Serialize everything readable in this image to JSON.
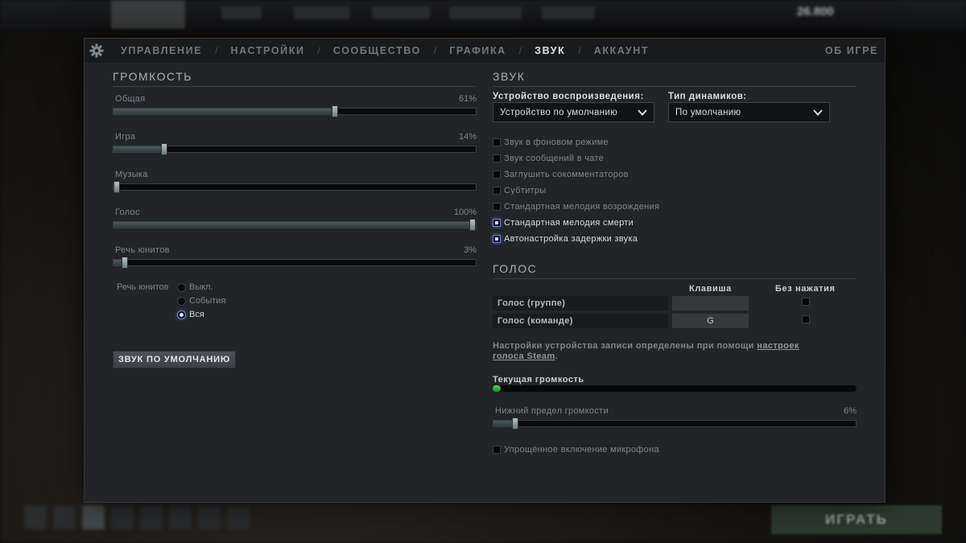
{
  "background": {
    "coins": "26.800",
    "play_label": "ИГРАТЬ"
  },
  "tabs": [
    {
      "label": "УПРАВЛЕНИЕ",
      "active": false
    },
    {
      "label": "НАСТРОЙКИ",
      "active": false
    },
    {
      "label": "СООБЩЕСТВО",
      "active": false
    },
    {
      "label": "ГРАФИКА",
      "active": false
    },
    {
      "label": "ЗВУК",
      "active": true
    },
    {
      "label": "АККАУНТ",
      "active": false
    }
  ],
  "about_label": "ОБ ИГРЕ",
  "volume": {
    "title": "ГРОМКОСТЬ",
    "sliders": [
      {
        "label": "Общая",
        "value_text": "61%",
        "value": 0.61
      },
      {
        "label": "Игра",
        "value_text": "14%",
        "value": 0.14
      },
      {
        "label": "Музыка",
        "value_text": "",
        "value": 0.0
      },
      {
        "label": "Голос",
        "value_text": "100%",
        "value": 1.0
      },
      {
        "label": "Речь юнитов",
        "value_text": "3%",
        "value": 0.03
      }
    ],
    "unit_speech": {
      "title": "Речь юнитов",
      "options": [
        {
          "label": "Выкл.",
          "selected": false
        },
        {
          "label": "События",
          "selected": false
        },
        {
          "label": "Вся",
          "selected": true
        }
      ]
    },
    "default_button": "ЗВУК ПО УМОЛЧАНИЮ"
  },
  "sound": {
    "title": "ЗВУК",
    "device_label": "Устройство воспроизведения:",
    "device_value": "Устройство по умолчанию",
    "speaker_label": "Тип динамиков:",
    "speaker_value": "По умолчанию",
    "options": [
      {
        "label": "Звук в фоновом режиме",
        "checked": false
      },
      {
        "label": "Звук сообщений в чате",
        "checked": false
      },
      {
        "label": "Заглушить сокомментаторов",
        "checked": false
      },
      {
        "label": "Субтитры",
        "checked": false
      },
      {
        "label": "Стандартная мелодия возрождения",
        "checked": false
      },
      {
        "label": "Стандартная мелодия смерти",
        "checked": true
      },
      {
        "label": "Автонастройка задержки звука",
        "checked": true
      }
    ]
  },
  "voice": {
    "title": "ГОЛОС",
    "key_header": "Клавиша",
    "open_mic_header": "Без нажатия",
    "rows": [
      {
        "label": "Голос (группе)",
        "key": "",
        "open_mic": false
      },
      {
        "label": "Голос (команде)",
        "key": "G",
        "open_mic": false
      }
    ],
    "info_text": "Настройки устройства записи определены при помощи ",
    "info_link": "настроек голоса Steam",
    "info_end": ".",
    "current_volume_label": "Текущая громкость",
    "current_volume": 0.02,
    "threshold_label": "Нижний предел громкости",
    "threshold_text": "6%",
    "threshold": 0.06,
    "simple_mic_label": "Упрощённое включение микрофона",
    "simple_mic": false
  },
  "colors": {
    "accent_glow": "#5a66c9",
    "meter_green": "#4fd36a"
  }
}
